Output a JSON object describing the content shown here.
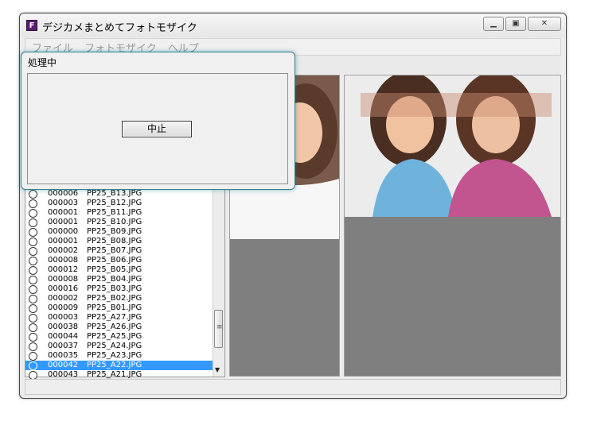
{
  "window": {
    "title": "デジカメまとめてフォトモザイク",
    "app_icon": "F"
  },
  "menu": [
    "ファイル",
    "フォトモザイク",
    "ヘルプ"
  ],
  "dialog": {
    "title": "処理中",
    "cancel_label": "中止"
  },
  "files": [
    {
      "count": "000006",
      "name": "PP25_B13.JPG"
    },
    {
      "count": "000003",
      "name": "PP25_B12.JPG"
    },
    {
      "count": "000001",
      "name": "PP25_B11.JPG"
    },
    {
      "count": "000001",
      "name": "PP25_B10.JPG"
    },
    {
      "count": "000000",
      "name": "PP25_B09.JPG"
    },
    {
      "count": "000001",
      "name": "PP25_B08.JPG"
    },
    {
      "count": "000002",
      "name": "PP25_B07.JPG"
    },
    {
      "count": "000008",
      "name": "PP25_B06.JPG"
    },
    {
      "count": "000012",
      "name": "PP25_B05.JPG"
    },
    {
      "count": "000008",
      "name": "PP25_B04.JPG"
    },
    {
      "count": "000016",
      "name": "PP25_B03.JPG"
    },
    {
      "count": "000002",
      "name": "PP25_B02.JPG"
    },
    {
      "count": "000009",
      "name": "PP25_B01.JPG"
    },
    {
      "count": "000003",
      "name": "PP25_A27.JPG"
    },
    {
      "count": "000038",
      "name": "PP25_A26.JPG"
    },
    {
      "count": "000044",
      "name": "PP25_A25.JPG"
    },
    {
      "count": "000037",
      "name": "PP25_A24.JPG"
    },
    {
      "count": "000035",
      "name": "PP25_A23.JPG"
    },
    {
      "count": "000042",
      "name": "PP25_A22.JPG",
      "selected": true
    },
    {
      "count": "000043",
      "name": "PP25_A21.JPG"
    }
  ],
  "icons": {
    "minimize": "minimize-icon",
    "maximize": "maximize-icon",
    "close": "close-icon",
    "radio": "radio-icon"
  },
  "colors": {
    "selection": "#3399ff",
    "canvas_gray": "#7f7f7f",
    "dialog_glow": "#3c7f8a"
  }
}
